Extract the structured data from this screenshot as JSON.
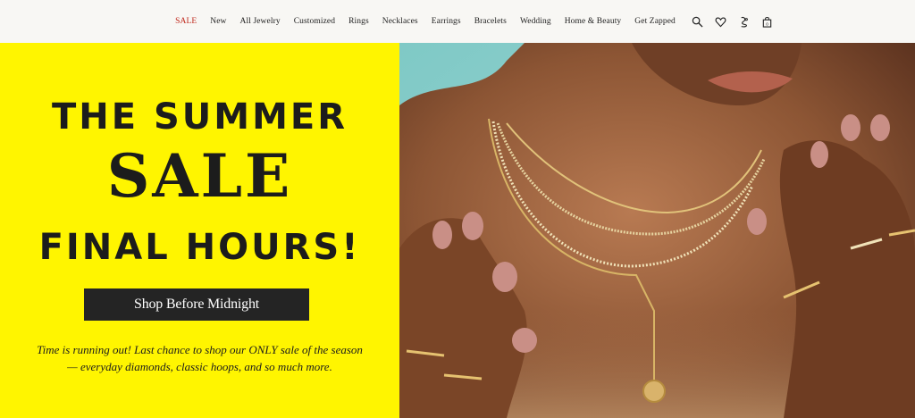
{
  "nav": {
    "links": [
      {
        "label": "SALE"
      },
      {
        "label": "New"
      },
      {
        "label": "All Jewelry"
      },
      {
        "label": "Customized"
      },
      {
        "label": "Rings"
      },
      {
        "label": "Necklaces"
      },
      {
        "label": "Earrings"
      },
      {
        "label": "Bracelets"
      },
      {
        "label": "Wedding"
      },
      {
        "label": "Home & Beauty"
      },
      {
        "label": "Get Zapped"
      }
    ],
    "icons": [
      "search-icon",
      "heart-icon",
      "account-icon",
      "bag-icon"
    ],
    "bag_count": "0"
  },
  "promo": {
    "line1": "THE SUMMER",
    "line2": "SALE",
    "line3": "FINAL HOURS!",
    "cta_label": "Shop Before Midnight",
    "description_line1": "Time is running out! Last chance to shop our ONLY sale of the season",
    "description_line2": "— everyday diamonds, classic hoops, and so much more."
  },
  "colors": {
    "promo_bg": "#fff500",
    "sale_link": "#c0281c",
    "cta_bg": "#242424"
  }
}
